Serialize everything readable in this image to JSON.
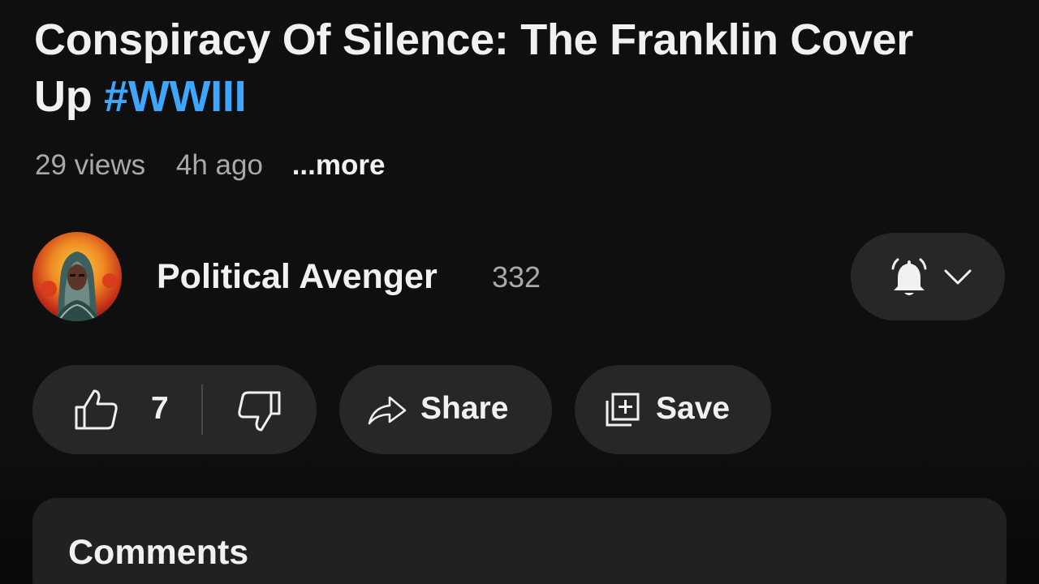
{
  "video": {
    "title_text": "Conspiracy Of Silence: The Franklin Cover Up",
    "hashtag": "#WWIII",
    "views": "29 views",
    "age": "4h ago",
    "more_label": "...more"
  },
  "channel": {
    "name": "Political Avenger",
    "subscribers": "332",
    "notification_icon": "bell-icon",
    "dropdown_icon": "chevron-down-icon"
  },
  "actions": {
    "like_icon": "thumbs-up-icon",
    "like_count": "7",
    "dislike_icon": "thumbs-down-icon",
    "share_icon": "share-arrow-icon",
    "share_label": "Share",
    "save_icon": "playlist-add-icon",
    "save_label": "Save"
  },
  "comments": {
    "heading": "Comments"
  },
  "colors": {
    "background": "#0f0f0f",
    "pill": "#272727",
    "hashtag": "#3ea6ff",
    "secondary_text": "#a9a9a9",
    "comments_panel": "#212121"
  }
}
